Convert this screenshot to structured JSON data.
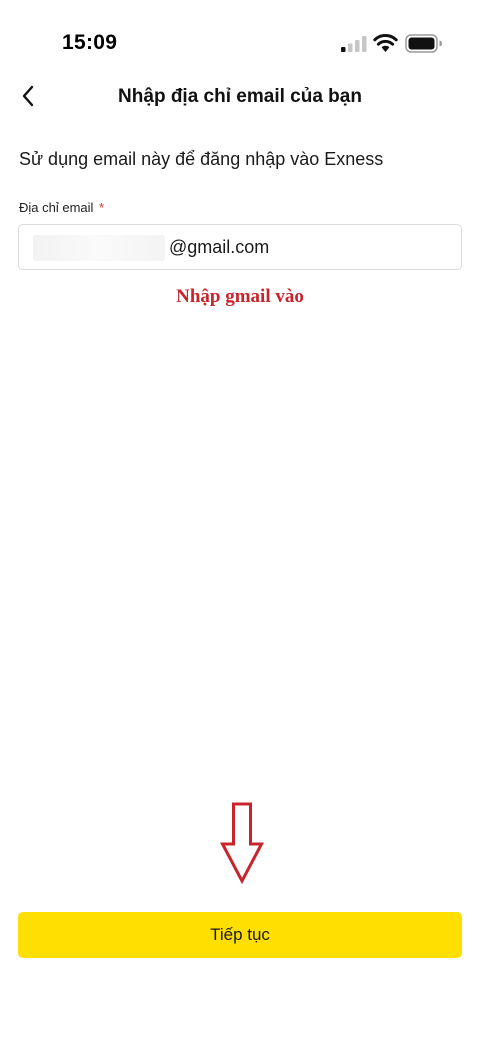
{
  "status_bar": {
    "time": "15:09",
    "icons": [
      "cellular-signal-icon",
      "wifi-icon",
      "battery-icon"
    ]
  },
  "header": {
    "back_icon": "chevron-left-icon",
    "title": "Nhập địa chỉ email của bạn"
  },
  "main": {
    "intro": "Sử dụng email này để đăng nhập vào Exness",
    "email_label": "Địa chỉ email",
    "required_mark": "*",
    "email_value": "@gmail.com"
  },
  "annotation": {
    "text": "Nhập gmail vào",
    "arrow_icon": "down-arrow-outline-icon"
  },
  "footer": {
    "continue_label": "Tiếp tục"
  },
  "colors": {
    "accent_button": "#ffde02",
    "required": "#d9342b",
    "annotation": "#c8242c"
  }
}
